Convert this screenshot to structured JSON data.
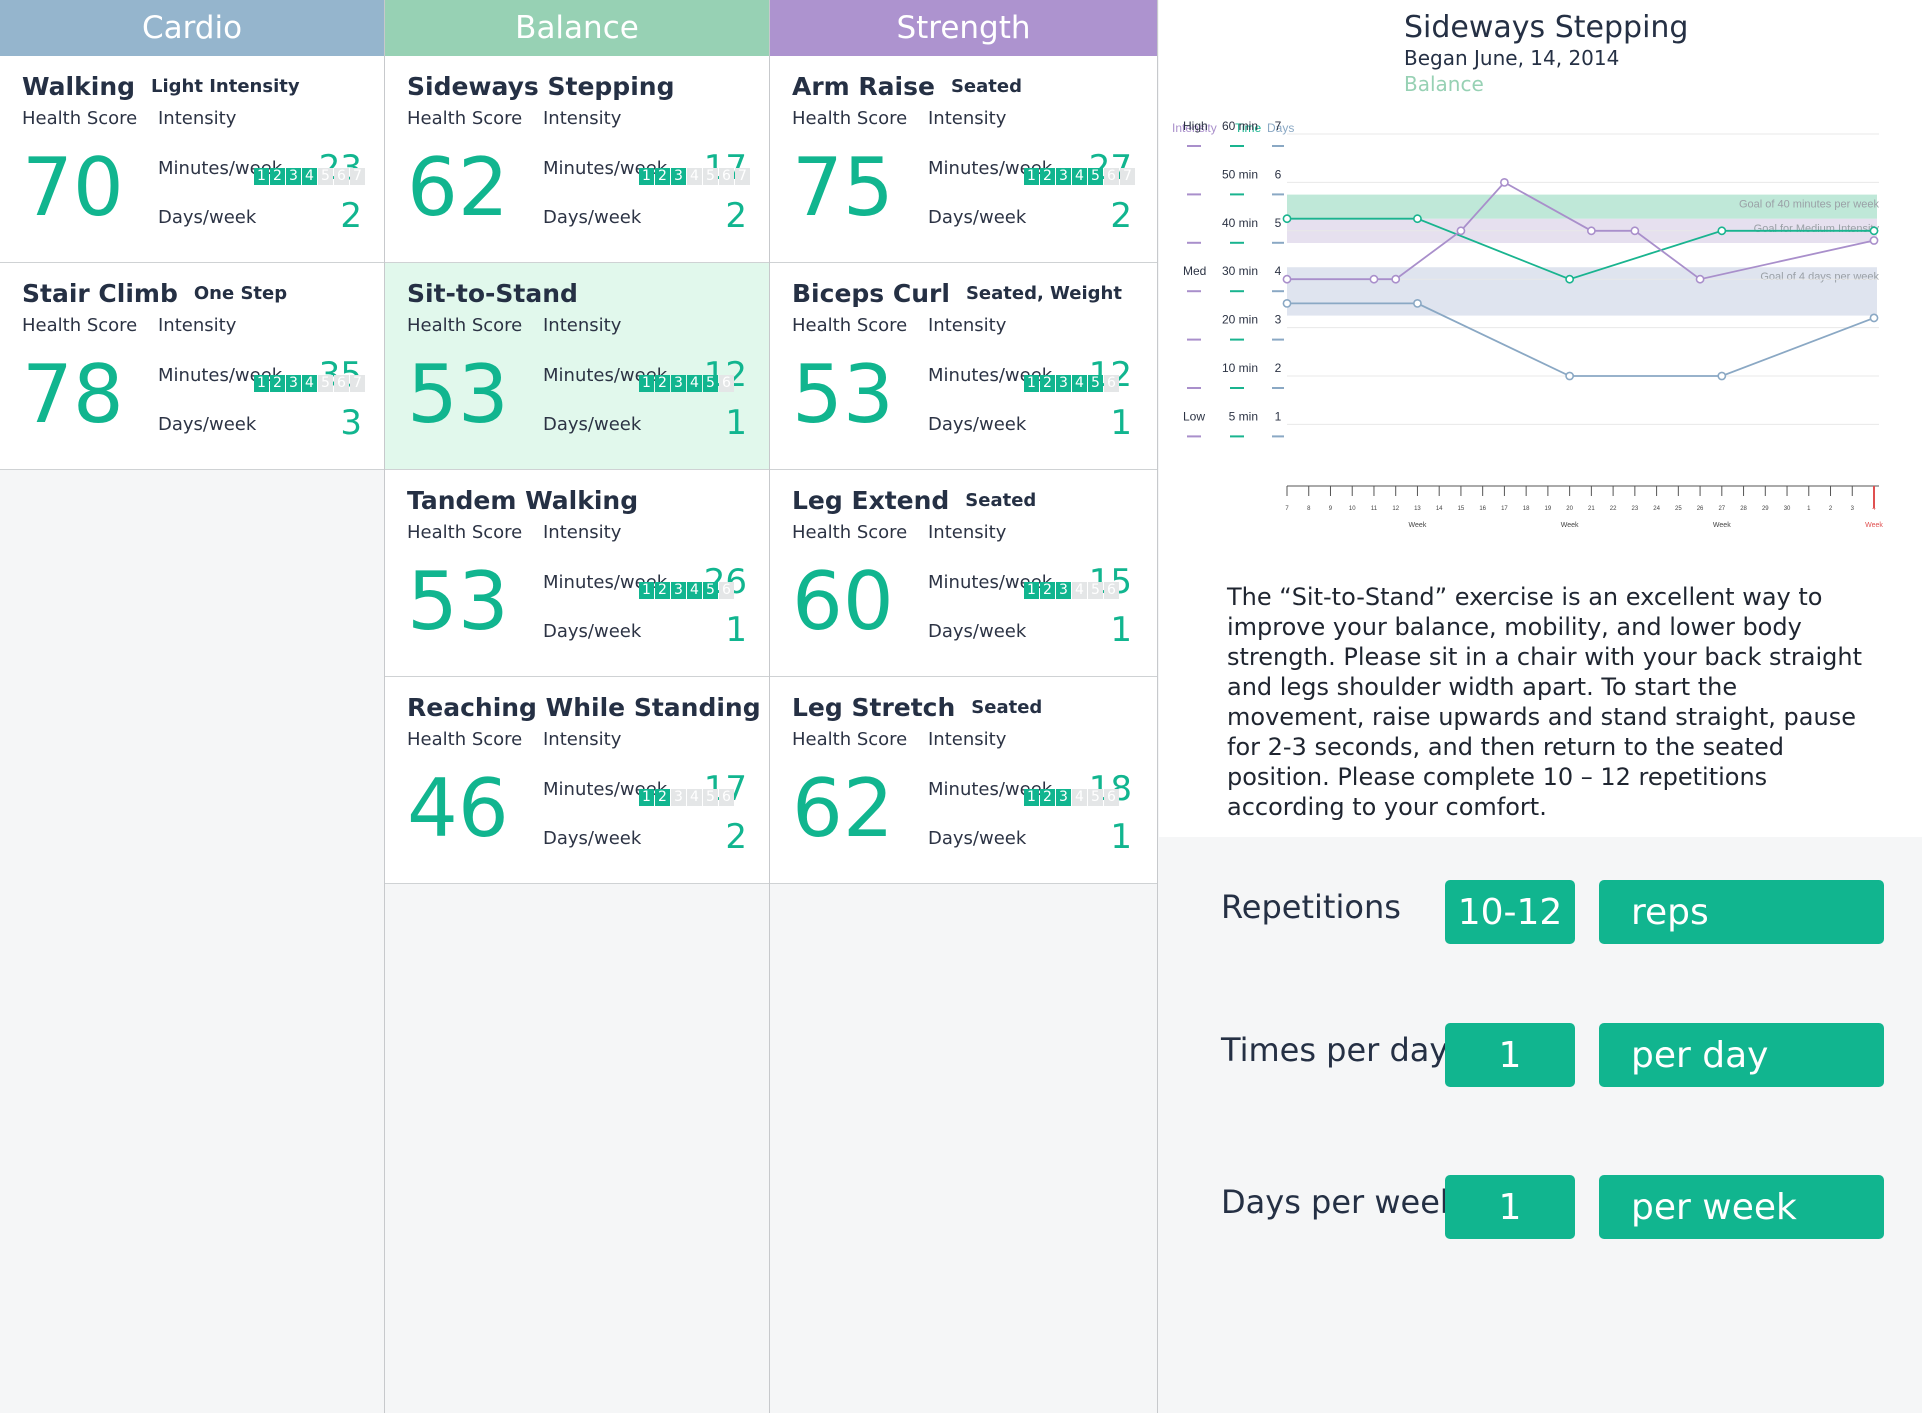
{
  "columns": [
    {
      "title": "Cardio",
      "color": "#95b5cd",
      "cards": [
        {
          "name": "Walking",
          "sub": "Light Intensity",
          "score": "70",
          "mins": "23",
          "days": "2",
          "intensity": 4,
          "max": 7
        },
        {
          "name": "Stair Climb",
          "sub": "One Step",
          "score": "78",
          "mins": "35",
          "days": "3",
          "intensity": 4,
          "max": 7
        }
      ]
    },
    {
      "title": "Balance",
      "color": "#97d1b4",
      "cards": [
        {
          "name": "Sideways Stepping",
          "sub": "",
          "score": "62",
          "mins": "17",
          "days": "2",
          "intensity": 3,
          "max": 7
        },
        {
          "name": "Sit-to-Stand",
          "sub": "",
          "score": "53",
          "mins": "12",
          "days": "1",
          "intensity": 5,
          "max": 6,
          "selected": true
        },
        {
          "name": "Tandem Walking",
          "sub": "",
          "score": "53",
          "mins": "26",
          "days": "1",
          "intensity": 5,
          "max": 6
        },
        {
          "name": "Reaching While Standing",
          "sub": "",
          "score": "46",
          "mins": "17",
          "days": "2",
          "intensity": 2,
          "max": 6
        }
      ]
    },
    {
      "title": "Strength",
      "color": "#ad93cf",
      "cards": [
        {
          "name": "Arm Raise",
          "sub": "Seated",
          "score": "75",
          "mins": "27",
          "days": "2",
          "intensity": 5,
          "max": 7
        },
        {
          "name": "Biceps Curl",
          "sub": "Seated, Weight",
          "score": "53",
          "mins": "12",
          "days": "1",
          "intensity": 5,
          "max": 6
        },
        {
          "name": "Leg Extend",
          "sub": "Seated",
          "score": "60",
          "mins": "15",
          "days": "1",
          "intensity": 3,
          "max": 6
        },
        {
          "name": "Leg Stretch",
          "sub": "Seated",
          "score": "62",
          "mins": "18",
          "days": "1",
          "intensity": 3,
          "max": 6
        }
      ]
    }
  ],
  "labels": {
    "health_score": "Health Score",
    "intensity": "Intensity",
    "minutes": "Minutes/week",
    "days": "Days/week"
  },
  "detail": {
    "title": "Sideways Stepping",
    "began": "Began June, 14, 2014",
    "category": "Balance",
    "description": "The “Sit-to-Stand” exercise is an excellent way to improve your balance, mobility, and lower body strength. Please sit in a chair with your back straight and legs shoulder width apart. To start the movement, raise upwards and stand straight, pause for 2-3 seconds, and then return to the seated position. Please complete 10 – 12 repetitions according to your comfort."
  },
  "controls": [
    {
      "label": "Repetitions",
      "value": "10-12",
      "unit": "reps"
    },
    {
      "label": "Times per day",
      "value": "1",
      "unit": "per day"
    },
    {
      "label": "Days per week",
      "value": "1",
      "unit": "per week"
    }
  ],
  "chart_data": {
    "type": "line",
    "title": "Sideways Stepping",
    "legend": [
      "Intensity",
      "Time",
      "Days"
    ],
    "y_intensity_labels": [
      "Low",
      "Med",
      "High"
    ],
    "y_time_labels": [
      "5 min",
      "10 min",
      "20 min",
      "30 min",
      "40 min",
      "50 min",
      "60 min"
    ],
    "y_day_labels": [
      "1",
      "2",
      "3",
      "4",
      "5",
      "6",
      "7"
    ],
    "x_ticks": [
      "7",
      "8",
      "9",
      "10",
      "11",
      "12",
      "13",
      "14",
      "15",
      "16",
      "17",
      "18",
      "19",
      "20",
      "21",
      "22",
      "23",
      "24",
      "25",
      "26",
      "27",
      "28",
      "29",
      "30",
      "1",
      "2",
      "3",
      "4"
    ],
    "x_major": [
      {
        "tick": "13",
        "label": "Week"
      },
      {
        "tick": "20",
        "label": "Week"
      },
      {
        "tick": "27",
        "label": "Week"
      },
      {
        "tick": "4",
        "label": "Week"
      }
    ],
    "goal_bands": [
      {
        "label": "Goal of 40 minutes per week",
        "from": 5.0,
        "to": 5.5,
        "color": "#bfe8d8"
      },
      {
        "label": "Goal for Medium Intensity",
        "from": 4.5,
        "to": 5.0,
        "color": "#e6e0ef"
      },
      {
        "label": "Goal of 4 days per week",
        "from": 3.0,
        "to": 4.0,
        "color": "#dfe4ef"
      }
    ],
    "series": [
      {
        "name": "Time",
        "color": "#19b48f",
        "points": [
          [
            7,
            5.25
          ],
          [
            13,
            5.25
          ],
          [
            20,
            4.0
          ],
          [
            27,
            5.0
          ],
          [
            4,
            5.0
          ]
        ]
      },
      {
        "name": "Intensity",
        "color": "#a98fcb",
        "points": [
          [
            7,
            4.0
          ],
          [
            11,
            4.0
          ],
          [
            12,
            4.0
          ],
          [
            15,
            5.0
          ],
          [
            17,
            6.0
          ],
          [
            21,
            5.0
          ],
          [
            23,
            5.0
          ],
          [
            26,
            4.0
          ],
          [
            4,
            4.8
          ]
        ]
      },
      {
        "name": "Days",
        "color": "#8aa8c4",
        "points": [
          [
            7,
            3.5
          ],
          [
            13,
            3.5
          ],
          [
            20,
            2.0
          ],
          [
            27,
            2.0
          ],
          [
            4,
            3.2
          ]
        ]
      }
    ]
  }
}
